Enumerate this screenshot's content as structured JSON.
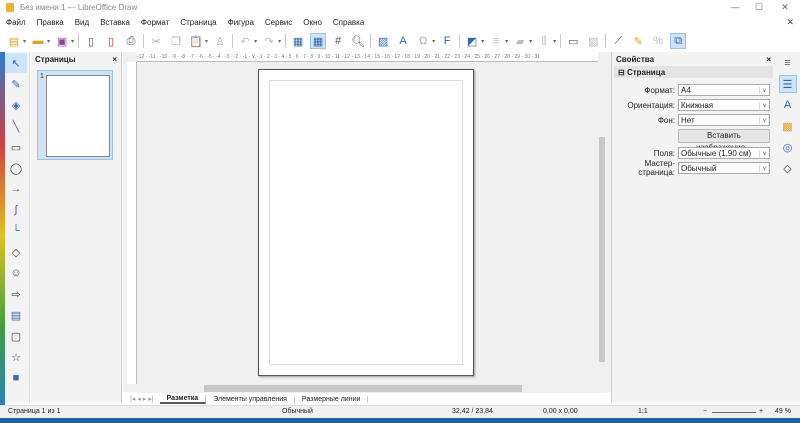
{
  "window": {
    "title": "Без имени 1 — LibreOffice Draw",
    "minimize": "—",
    "maximize": "☐",
    "close": "✕",
    "doc_close": "✕"
  },
  "menu": [
    "Файл",
    "Правка",
    "Вид",
    "Вставка",
    "Формат",
    "Страница",
    "Фигура",
    "Сервис",
    "Окно",
    "Справка"
  ],
  "pages_panel": {
    "title": "Страницы",
    "close": "×",
    "page_number": "1"
  },
  "ruler": {
    "horizontal": "-12 · -11 · -10 · -9 · -8 · -7 · -6 · -5 · -4 · -3 · -2 · -1 · ⊻ · 1 · 2 · 3 · 4 · 5 · 6 · 7 · 8 · 9 · 10 · 11 · 12 · 13 · 14 · 15 · 16 · 17 · 18 · 19 · 20 · 21 · 22 · 23 · 24 · 25 · 26 · 27 · 28 · 29 · 30 · 31"
  },
  "tabs": {
    "nav": "|◂ ◂ ▸ ▸|",
    "items": [
      "Разметка",
      "Элементы управления",
      "Размерные линии"
    ]
  },
  "sidebar": {
    "title": "Свойства",
    "close": "×",
    "menu": "≡",
    "section": "Страница",
    "fields": [
      {
        "label": "Формат:",
        "value": "A4"
      },
      {
        "label": "Ориентация:",
        "value": "Книжная"
      },
      {
        "label": "Фон:",
        "value": "Нет"
      }
    ],
    "insert_image": "Вставить изображение...",
    "fields2": [
      {
        "label": "Поля:",
        "value": "Обычные (1,90 см)"
      },
      {
        "label": "Мастер-страница:",
        "value": "Обычный"
      }
    ]
  },
  "status": {
    "page": "Страница 1 из 1",
    "master": "Обычный",
    "position": "32,42 / 23,84",
    "size": "0,00 x 0,00",
    "scale": "1:1",
    "zoom": "49 %",
    "zoom_minus": "−",
    "zoom_plus": "+"
  }
}
